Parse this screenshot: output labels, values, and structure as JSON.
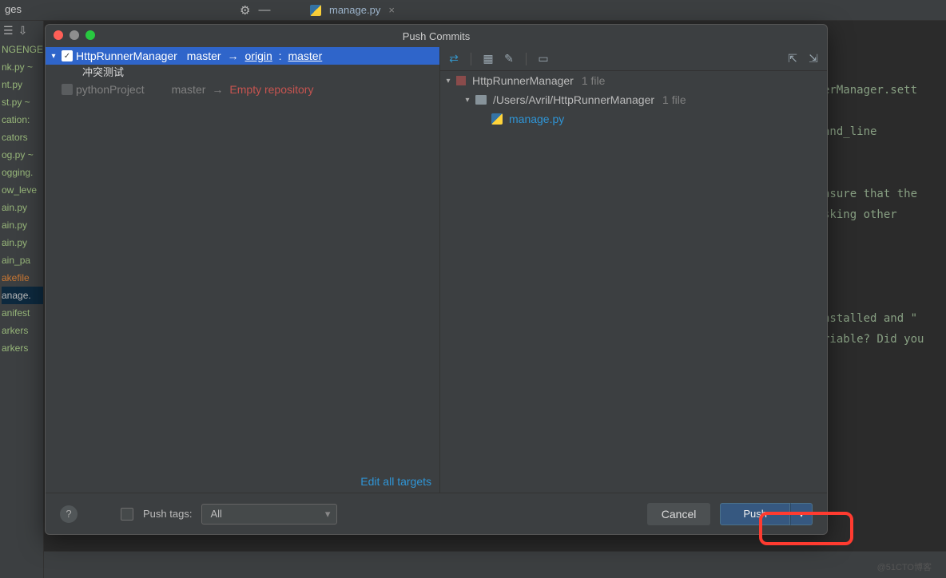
{
  "editor": {
    "tab_label": "manage.py",
    "top_text": "ges",
    "code_lines": [
      "erManager.sett",
      "",
      "and_line",
      "",
      "",
      "nsure that the",
      "sking other",
      "",
      "",
      "",
      "",
      "nstalled and \"",
      "riable? Did you"
    ],
    "sidebar_files": [
      "NGENGE.",
      "nk.py ~",
      "nt.py",
      "st.py ~",
      "cation:",
      "cators",
      "og.py ~",
      "ogging.",
      "ow_leve",
      "ain.py",
      "ain.py",
      "ain.py",
      "ain_pa",
      "akefile",
      "anage.",
      "anifest",
      "arkers",
      "arkers"
    ]
  },
  "dialog": {
    "title": "Push Commits",
    "repos": [
      {
        "name": "HttpRunnerManager",
        "local_branch": "master",
        "remote": "origin",
        "remote_branch": "master",
        "checked": true,
        "selected": true,
        "commit_message": "冲突测试"
      },
      {
        "name": "pythonProject",
        "local_branch": "master",
        "remote_text": "Empty repository",
        "checked": false,
        "selected": false
      }
    ],
    "edit_targets": "Edit all targets",
    "files": {
      "root": "HttpRunnerManager",
      "root_count": "1 file",
      "path": "/Users/Avril/HttpRunnerManager",
      "path_count": "1 file",
      "file": "manage.py"
    },
    "footer": {
      "push_tags_label": "Push tags:",
      "push_tags_value": "All",
      "cancel": "Cancel",
      "push": "Push"
    }
  },
  "watermark": "@51CTO博客"
}
